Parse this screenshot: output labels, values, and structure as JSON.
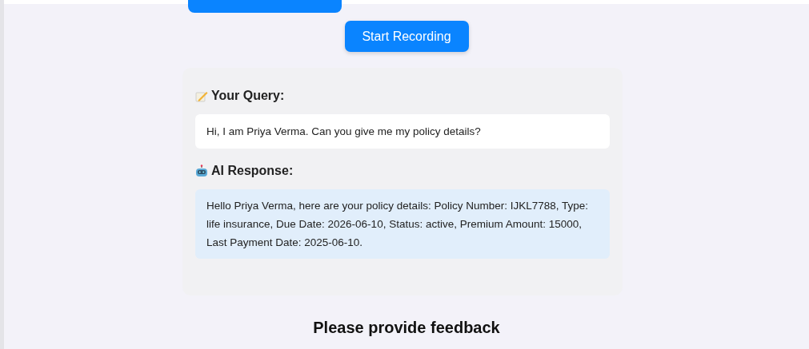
{
  "record_button": {
    "label": "Start Recording"
  },
  "query": {
    "heading": "Your Query:",
    "text": "Hi, I am Priya Verma. Can you give me my policy details?"
  },
  "response": {
    "heading": "AI Response:",
    "text": "Hello Priya Verma, here are your policy details: Policy Number: IJKL7788, Type: life insurance, Due Date: 2026-06-10, Status: active, Premium Amount: 15000, Last Payment Date: 2025-06-10."
  },
  "feedback": {
    "heading": "Please provide feedback"
  }
}
